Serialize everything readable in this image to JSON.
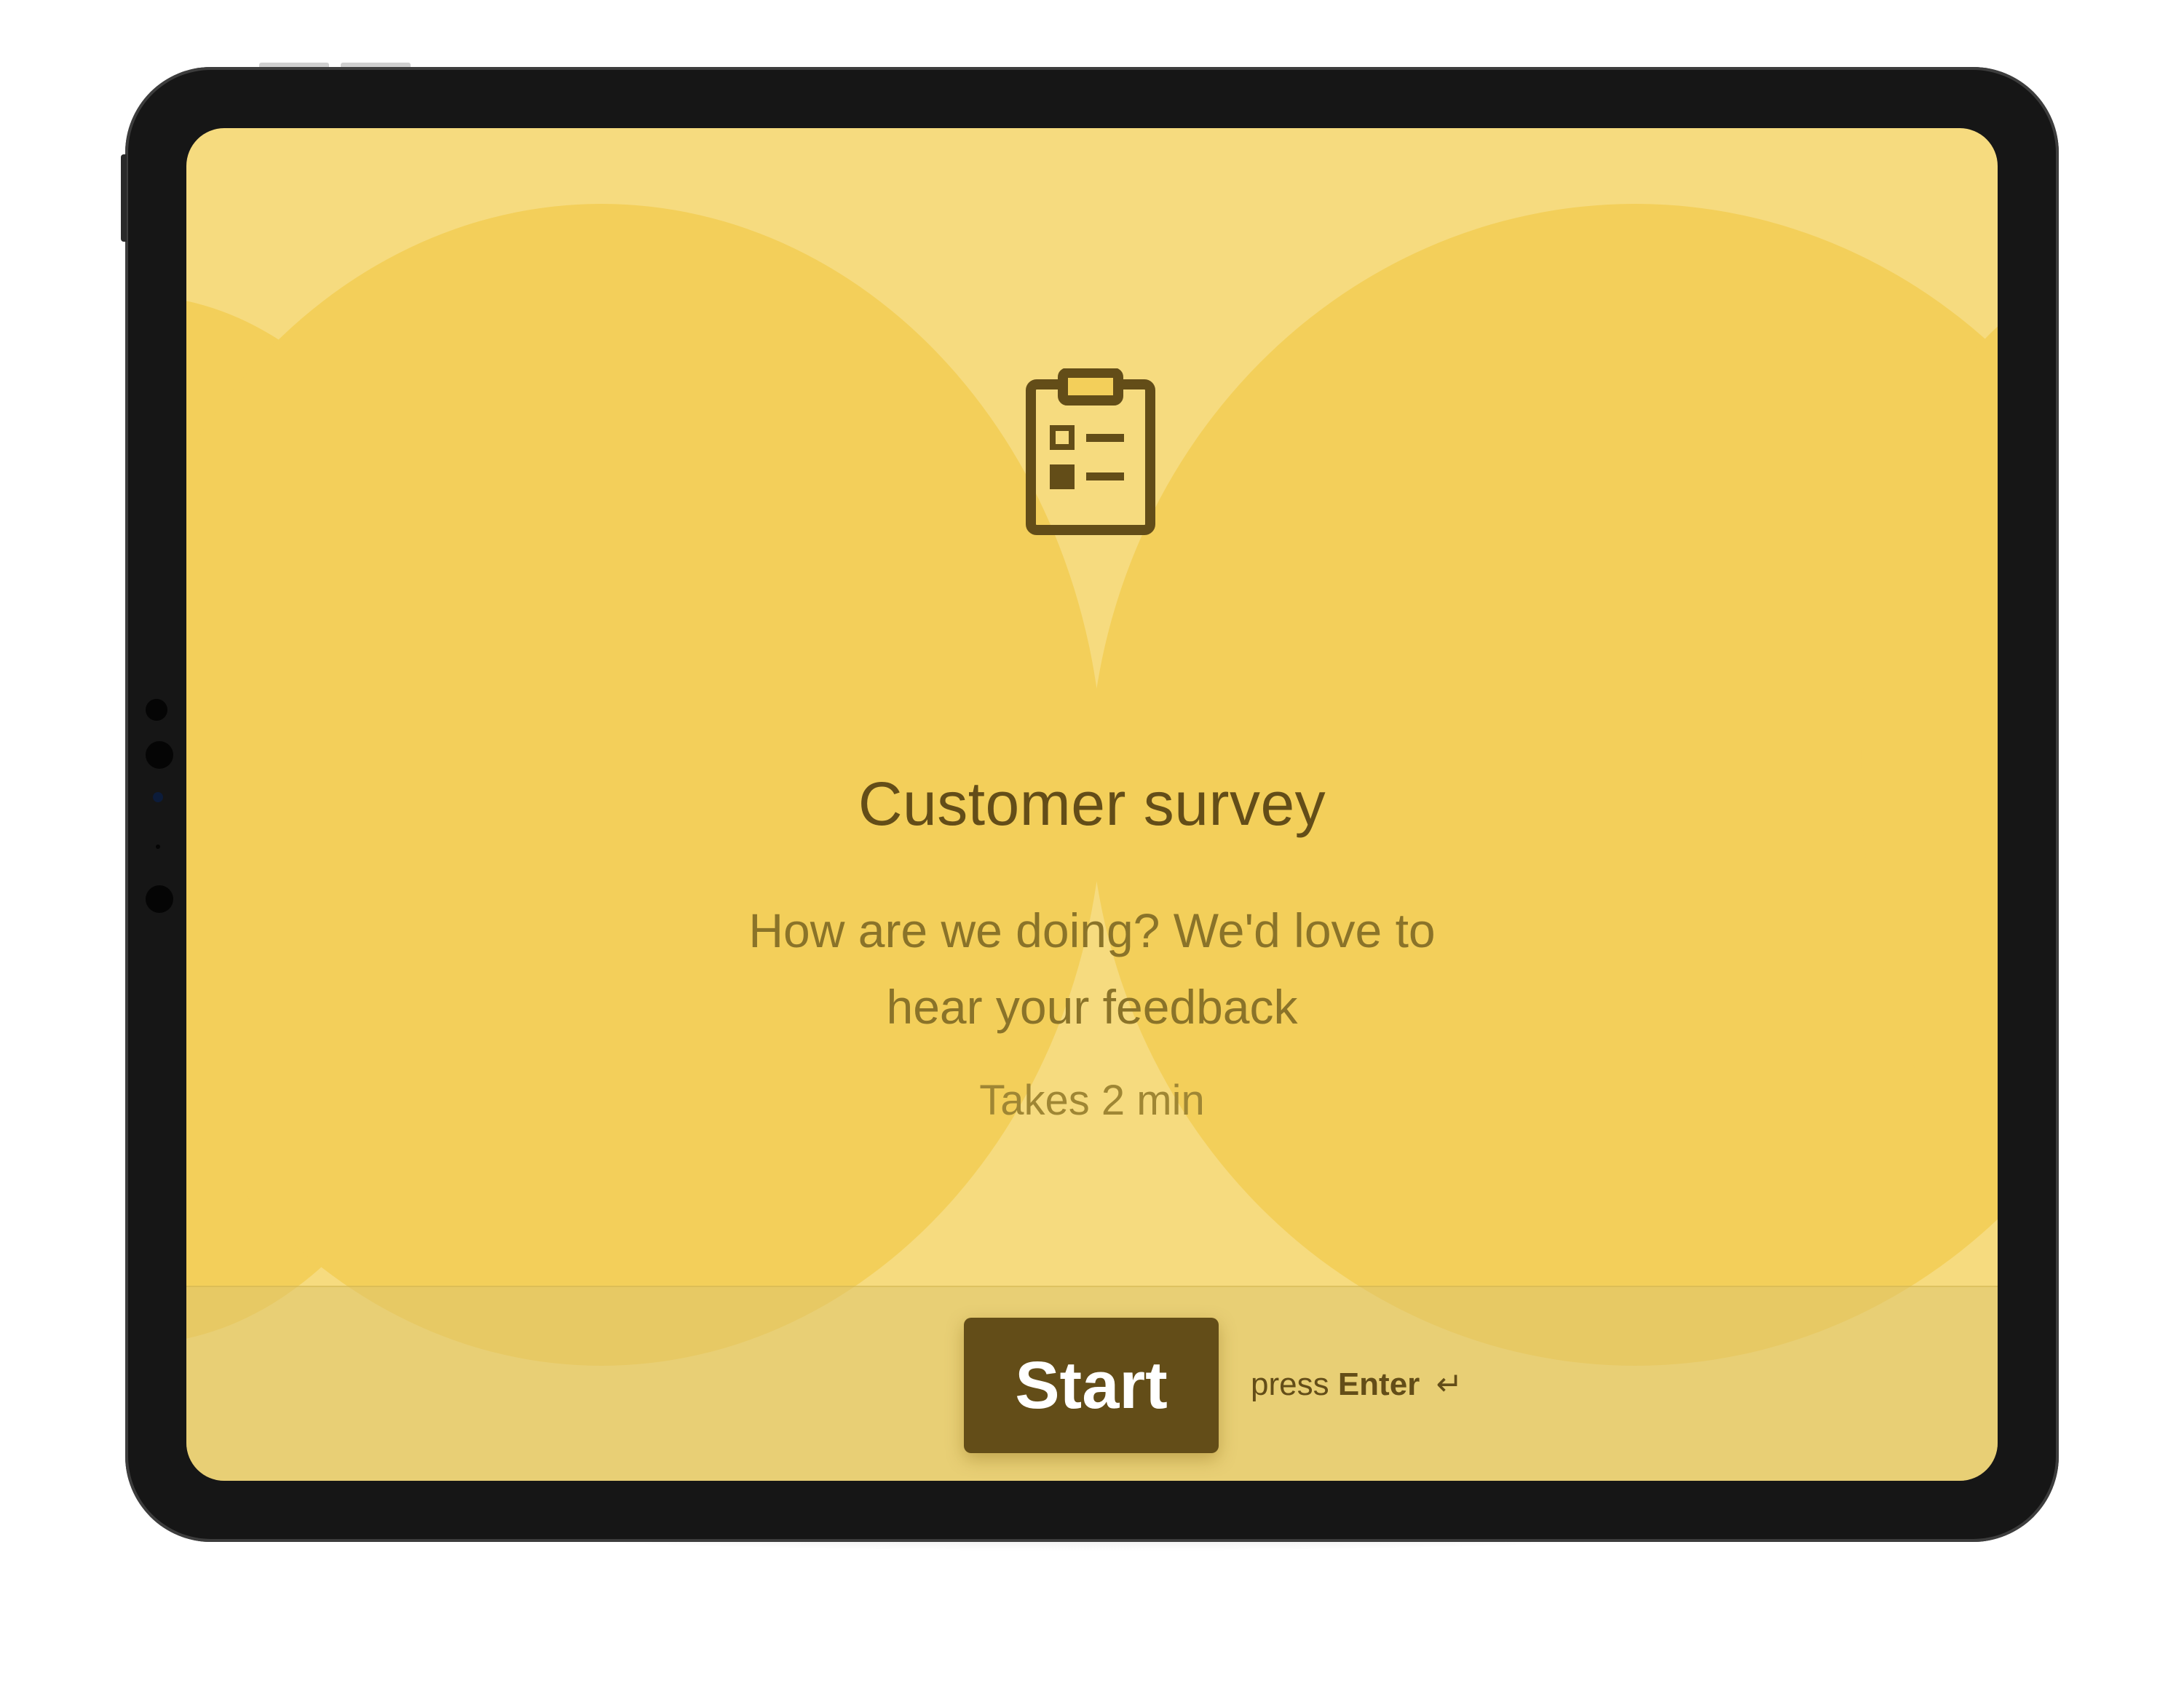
{
  "survey": {
    "icon": "clipboard-checklist-icon",
    "title": "Customer survey",
    "subtitle": "How are we doing? We'd love to hear your feedback",
    "duration": "Takes 2 min"
  },
  "footer": {
    "start_label": "Start",
    "hint_prefix": "press",
    "hint_key": "Enter",
    "hint_icon": "↵"
  },
  "colors": {
    "background": "#f6db7f",
    "blob": "#f3cf5a",
    "accent": "#634d18",
    "subtitle": "#8a7329",
    "footer": "#e7cd75"
  }
}
